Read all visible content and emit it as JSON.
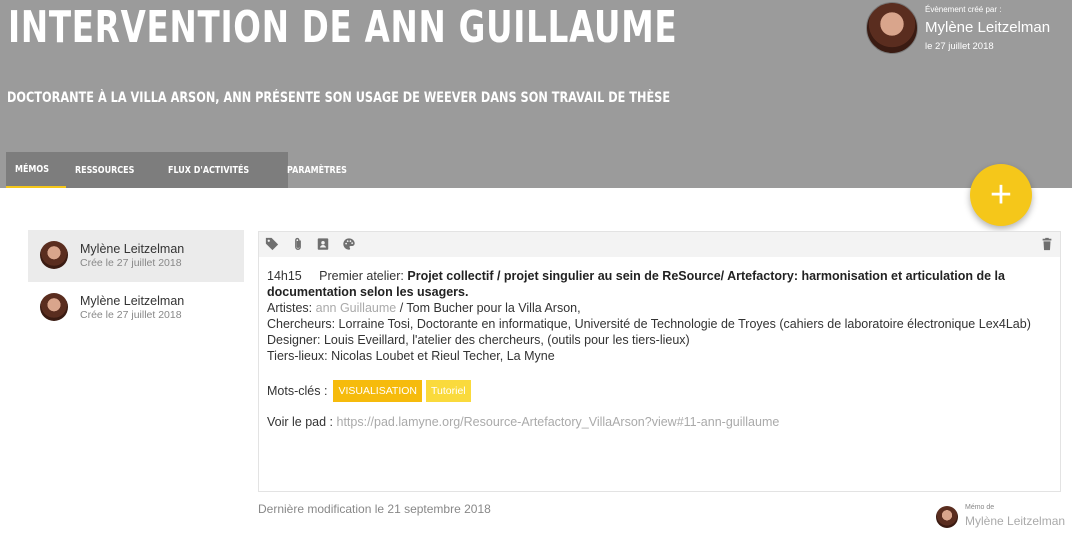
{
  "header": {
    "title": "INTERVENTION DE ANN GUILLAUME",
    "subtitle": "DOCTORANTE À LA VILLA ARSON, ANN PRÉSENTE SON USAGE DE WEEVER DANS SON TRAVAIL DE THÈSE",
    "bg_color": "#9b9b9b"
  },
  "creator": {
    "label": "Évènement créé par :",
    "name": "Mylène Leitzelman",
    "date": "le 27 juillet 2018"
  },
  "tabs": [
    {
      "label": "MÉMOS",
      "active": true
    },
    {
      "label": "RESSOURCES",
      "active": false
    },
    {
      "label": "FLUX D'ACTIVITÉS",
      "active": false
    },
    {
      "label": "PARAMÈTRES",
      "active": false
    }
  ],
  "fab": {
    "label": "+",
    "color": "#f5c71a"
  },
  "memos": [
    {
      "author": "Mylène Leitzelman",
      "date": "Crée le 27 juillet 2018",
      "selected": true
    },
    {
      "author": "Mylène Leitzelman",
      "date": "Crée le 27 juillet 2018",
      "selected": false
    }
  ],
  "toolbar": {
    "icons": [
      "tag-icon",
      "paperclip-icon",
      "contact-card-icon",
      "palette-icon",
      "trash-icon"
    ]
  },
  "memo_content": {
    "time": "14h15",
    "intro": "Premier atelier: ",
    "heading": "Projet collectif / projet singulier au sein de ReSource/ Artefactory: harmonisation et articulation de la documentation selon les usagers.",
    "artists_label": "Artistes: ",
    "artists_link": "ann Guillaume",
    "artists_rest": " / Tom Bucher pour la Villa Arson,",
    "researchers": "Chercheurs: Lorraine Tosi, Doctorante en informatique, Université de Technologie de Troyes (cahiers de laboratoire électronique Lex4Lab)",
    "designer": "Designer: Louis Eveillard, l'atelier des chercheurs, (outils pour les tiers-lieux)",
    "third_places": "Tiers-lieux: Nicolas Loubet et Rieul Techer, La Myne",
    "keywords_label": "Mots-clés :",
    "keywords": [
      "VISUALISATION",
      "Tutoriel"
    ],
    "pad_label": "Voir le pad : ",
    "pad_url": "https://pad.lamyne.org/Resource-Artefactory_VillaArson?view#11-ann-guillaume"
  },
  "last_modified": "Dernière modification le 21 septembre 2018",
  "memo_by": {
    "label": "Mémo de",
    "name": "Mylène Leitzelman"
  },
  "colors": {
    "accent": "#f5c71a",
    "tag_primary": "#f6bb0c",
    "tag_secondary": "#fada3c"
  }
}
